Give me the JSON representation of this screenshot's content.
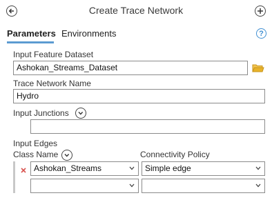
{
  "header": {
    "title": "Create Trace Network",
    "back_icon": "back-arrow-icon",
    "add_icon": "plus-icon"
  },
  "tabs": [
    {
      "label": "Parameters",
      "active": true
    },
    {
      "label": "Environments",
      "active": false
    }
  ],
  "help_label": "?",
  "params": {
    "input_feature_dataset": {
      "label": "Input Feature Dataset",
      "value": "Ashokan_Streams_Dataset"
    },
    "trace_network_name": {
      "label": "Trace Network Name",
      "value": "Hydro"
    },
    "input_junctions": {
      "label": "Input Junctions",
      "value": ""
    },
    "input_edges": {
      "label": "Input Edges",
      "columns": {
        "class_name": "Class Name",
        "connectivity_policy": "Connectivity Policy"
      },
      "rows": [
        {
          "class_name": "Ashokan_Streams",
          "connectivity_policy": "Simple edge"
        },
        {
          "class_name": "",
          "connectivity_policy": ""
        }
      ]
    }
  },
  "colors": {
    "accent": "#5c9bd1",
    "remove_x": "#d9534f",
    "folder": "#e8b32a"
  }
}
